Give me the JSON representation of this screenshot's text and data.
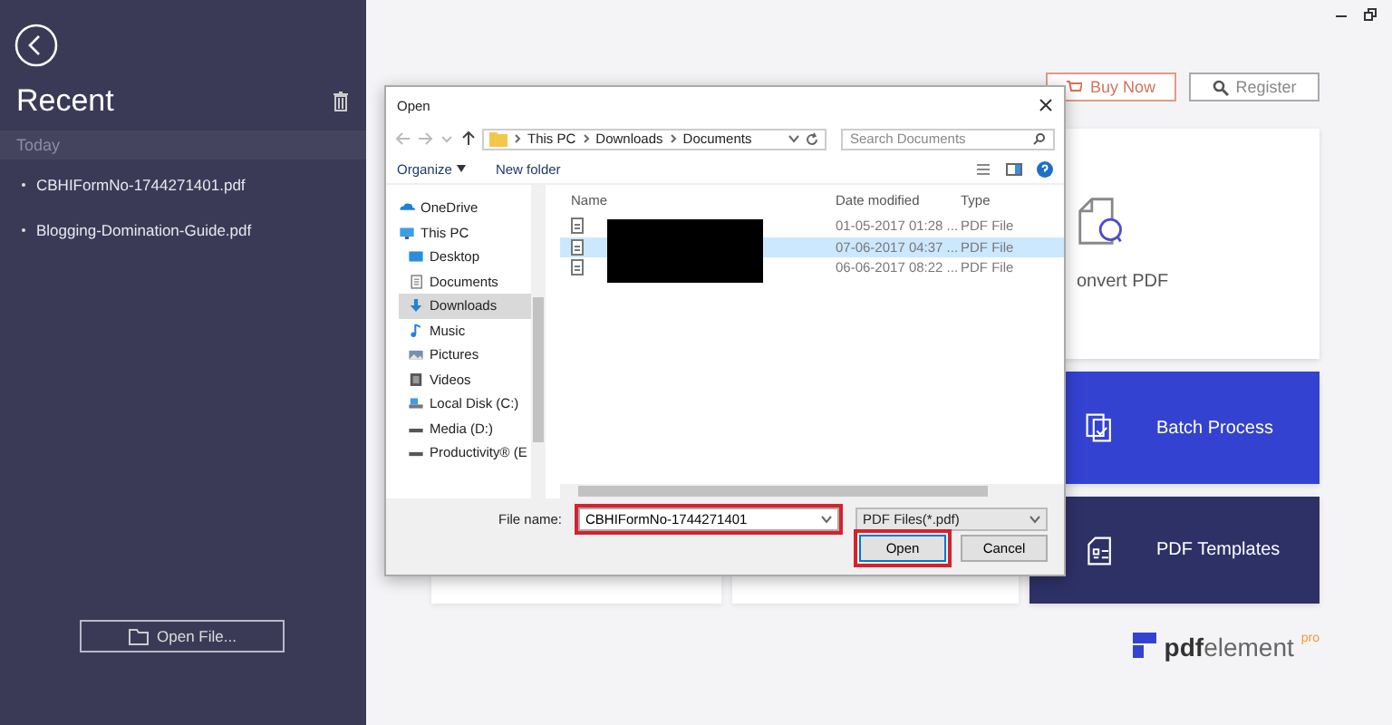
{
  "sidebar": {
    "title": "Recent",
    "section": "Today",
    "items": [
      {
        "label": "CBHIFormNo-1744271401.pdf"
      },
      {
        "label": "Blogging-Domination-Guide.pdf"
      }
    ],
    "open_button": "Open File..."
  },
  "header": {
    "buy_button": "Buy Now",
    "register_button": "Register"
  },
  "tiles": [
    {
      "kind": "convert",
      "label": "onvert PDF",
      "color": "#ffffff"
    },
    {
      "kind": "batch",
      "label": "Batch Process",
      "color": "#3342d1"
    },
    {
      "kind": "templates",
      "label": "PDF Templates",
      "color": "#2e3166"
    }
  ],
  "logo": {
    "brand": "pdf",
    "name": "element",
    "badge": "pro"
  },
  "dialog": {
    "title": "Open",
    "breadcrumb": [
      "This PC",
      "Downloads",
      "Documents"
    ],
    "search": {
      "placeholder": "Search Documents"
    },
    "toolbar": [
      "Organize",
      "New folder"
    ],
    "nav": [
      {
        "kind": "cloud",
        "label": "OneDrive",
        "selected": false
      },
      {
        "kind": "pc",
        "label": "This PC",
        "selected": false,
        "children": [
          {
            "kind": "desktop",
            "label": "Desktop",
            "selected": false
          },
          {
            "kind": "document",
            "label": "Documents",
            "selected": false
          },
          {
            "kind": "download",
            "label": "Downloads",
            "selected": true
          },
          {
            "kind": "music",
            "label": "Music",
            "selected": false
          },
          {
            "kind": "picture",
            "label": "Pictures",
            "selected": false
          },
          {
            "kind": "video",
            "label": "Videos",
            "selected": false
          },
          {
            "kind": "disk",
            "label": "Local Disk (C:)",
            "selected": false
          },
          {
            "kind": "drive",
            "label": "Media (D:)",
            "selected": false
          },
          {
            "kind": "drive",
            "label": "Productivity® (E",
            "selected": false
          }
        ]
      }
    ],
    "columns": [
      "Name",
      "Date modified",
      "Type"
    ],
    "rows": [
      {
        "date": "01-05-2017 01:28 ...",
        "type": "PDF File",
        "selected": false
      },
      {
        "date": "07-06-2017 04:37 ...",
        "type": "PDF File",
        "selected": true
      },
      {
        "date": "06-06-2017 08:22 ...",
        "type": "PDF File",
        "selected": false
      }
    ],
    "file_name_label": "File name:",
    "file_name": "CBHIFormNo-1744271401",
    "file_type": "PDF Files(*.pdf)",
    "buttons": [
      "Open",
      "Cancel"
    ]
  }
}
